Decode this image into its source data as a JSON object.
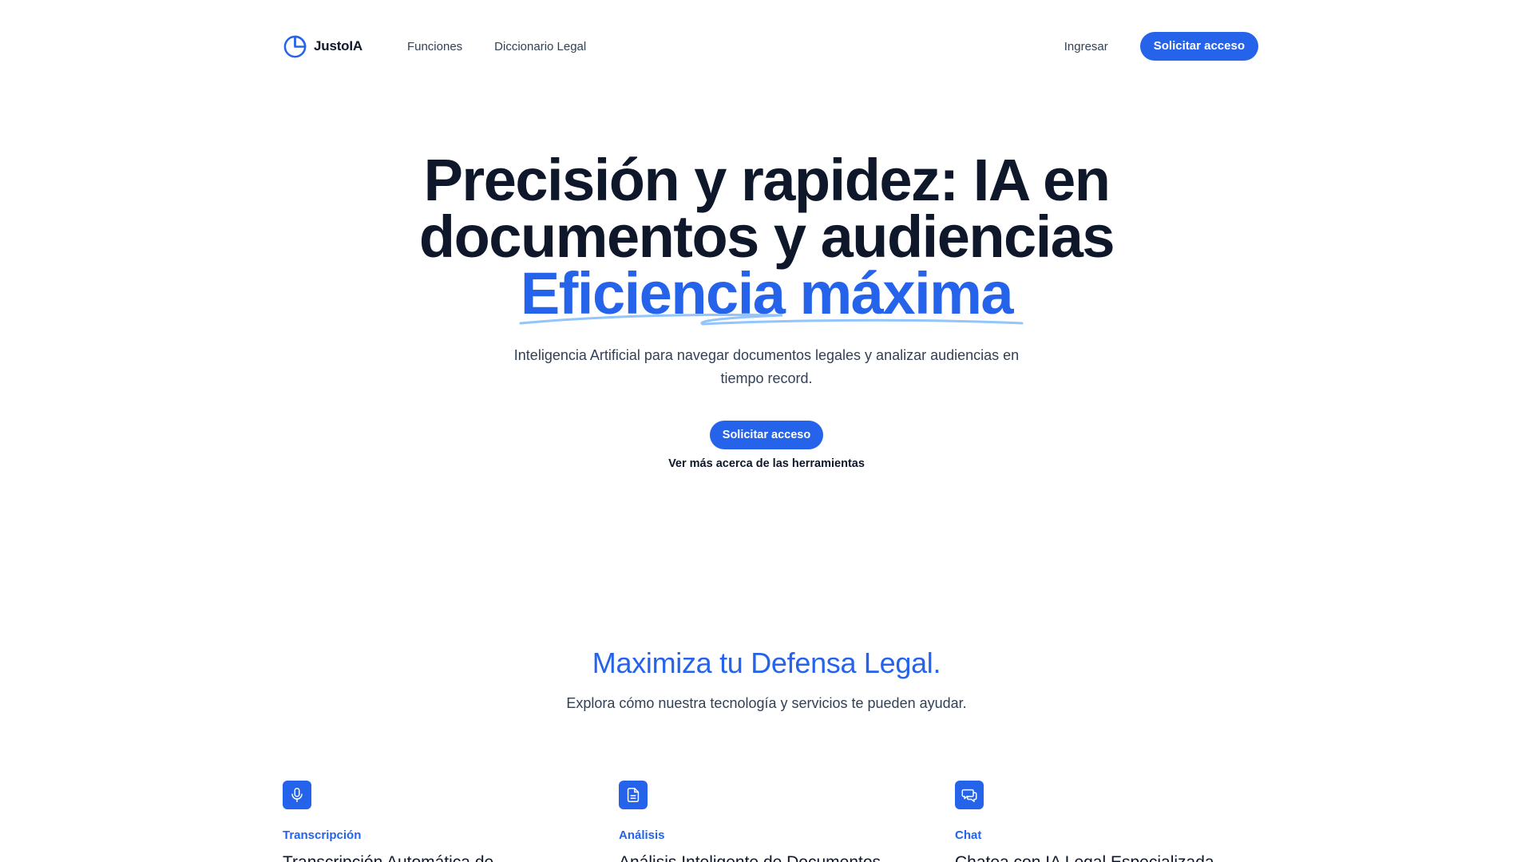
{
  "nav": {
    "brand": "JustoIA",
    "links": [
      "Funciones",
      "Diccionario Legal"
    ],
    "login": "Ingresar",
    "cta": "Solicitar acceso"
  },
  "hero": {
    "title_line1": "Precisión y rapidez: IA en",
    "title_line2": "documentos y audiencias",
    "title_accent": "Eficiencia máxima",
    "subtitle": "Inteligencia Artificial para navegar documentos legales y analizar audiencias en tiempo record.",
    "cta": "Solicitar acceso",
    "more_link": "Ver más acerca de las herramientas"
  },
  "features": {
    "title": "Maximiza tu Defensa Legal.",
    "subtitle": "Explora cómo nuestra tecnología y servicios te pueden ayudar.",
    "items": [
      {
        "icon": "microphone-icon",
        "tag": "Transcripción",
        "title": "Transcripción Automática de"
      },
      {
        "icon": "document-icon",
        "tag": "Análisis",
        "title": "Análisis Inteligente de Documentos"
      },
      {
        "icon": "chat-bubbles-icon",
        "tag": "Chat",
        "title": "Chatea con IA Legal Especializada"
      }
    ]
  },
  "colors": {
    "primary": "#2563eb",
    "text": "#0f172a",
    "muted": "#334155",
    "swash": "#93c5fd"
  }
}
